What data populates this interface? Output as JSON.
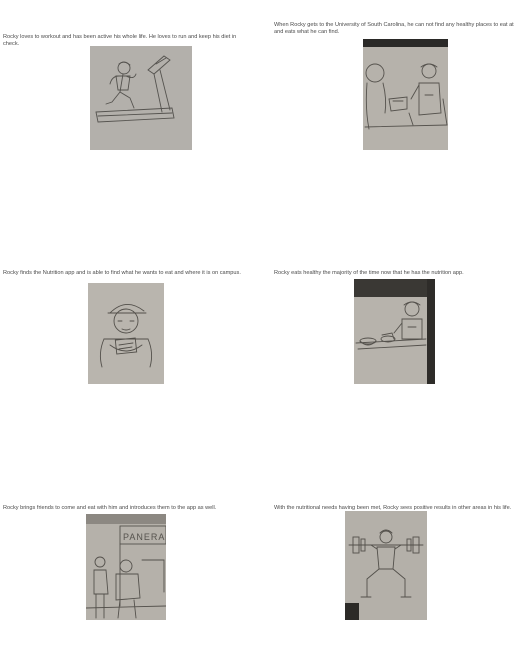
{
  "panels": [
    {
      "caption": "Rocky loves to workout and has been active his whole life. He loves to run and keep his diet in check."
    },
    {
      "caption": "When Rocky gets to the University of South Carolina, he can not find any healthy places to eat at and eats what he can find."
    },
    {
      "caption": "Rocky finds the Nutrition app and is able to find what he wants to eat and where it is on campus."
    },
    {
      "caption": "Rocky eats healthy the majority of the time now that he has the nutrition app."
    },
    {
      "caption": "Rocky brings friends to come and eat with him and introduces them to the app as well."
    },
    {
      "caption": "With the nutritional needs having been met, Rocky sees positive results in other areas in his life."
    }
  ],
  "sign_text": "PANERA"
}
